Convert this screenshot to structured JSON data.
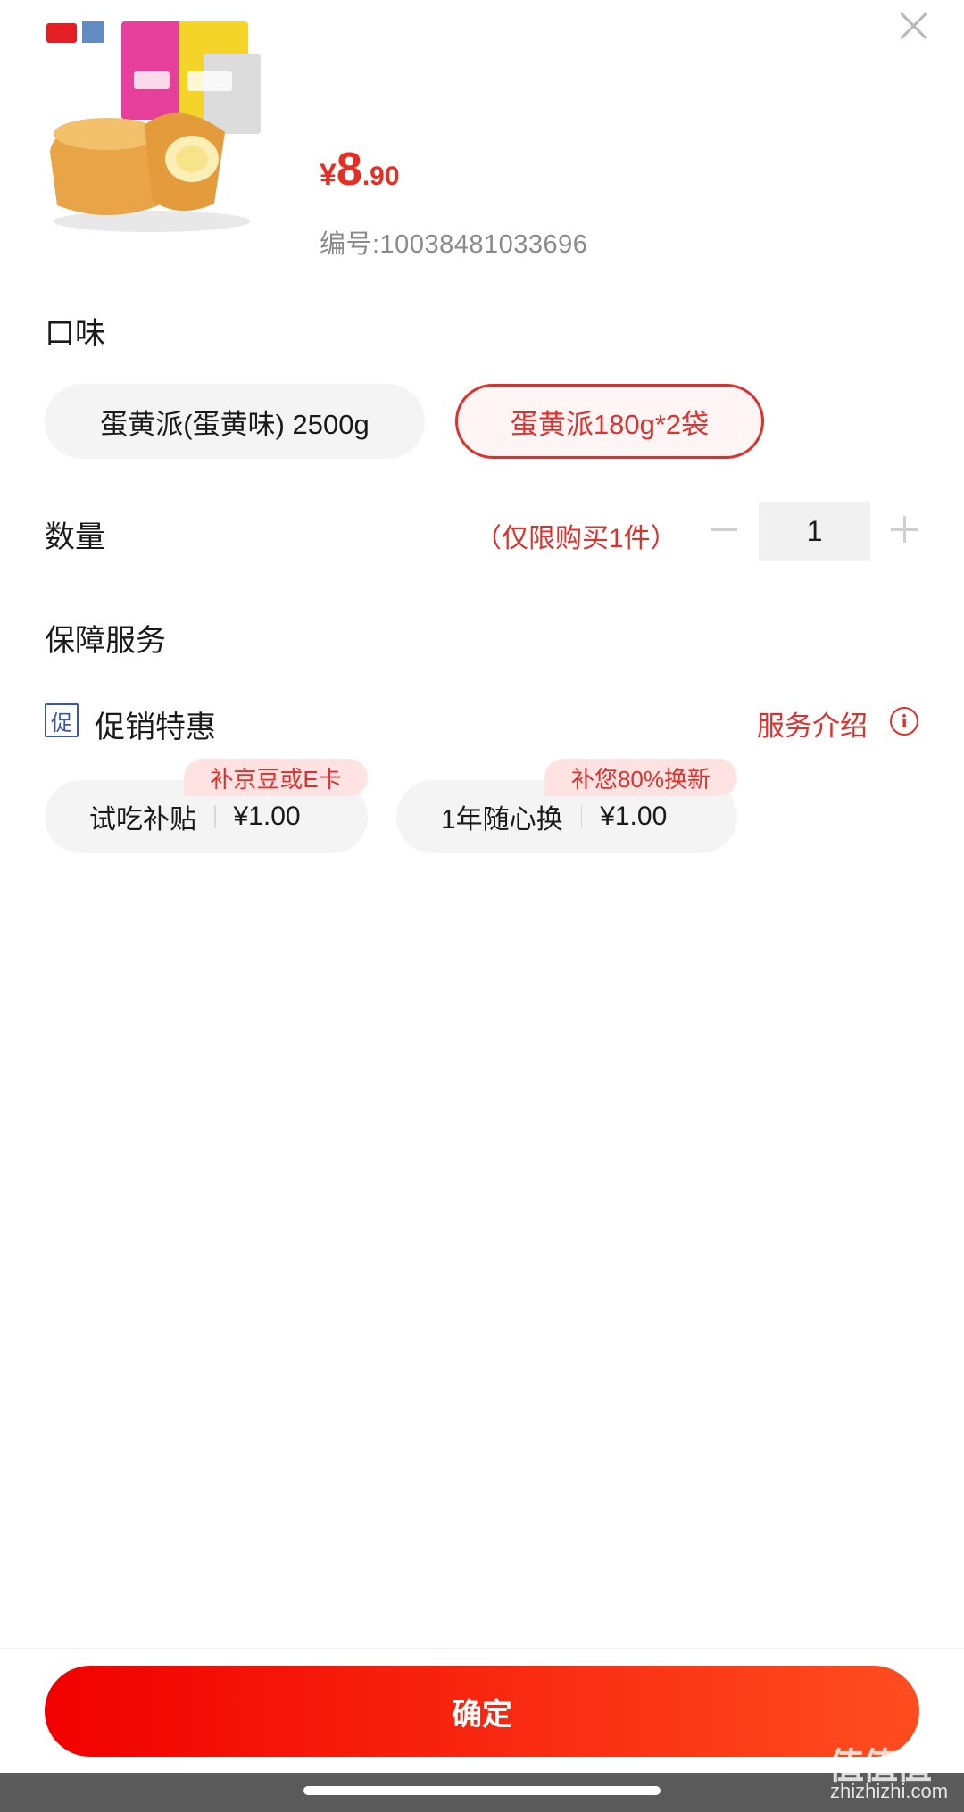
{
  "product": {
    "price_symbol": "¥",
    "price_integer": "8",
    "price_decimal": ".90",
    "sku": "编号:10038481033696"
  },
  "flavor": {
    "title": "口味",
    "options": [
      {
        "label": "蛋黄派(蛋黄味) 2500g",
        "selected": false
      },
      {
        "label": "蛋黄派180g*2袋",
        "selected": true
      }
    ]
  },
  "quantity": {
    "title": "数量",
    "limit_note": "（仅限购买1件）",
    "value": "1"
  },
  "guarantee": {
    "title": "保障服务"
  },
  "promotion": {
    "icon_char": "促",
    "title": "促销特惠",
    "service_link": "服务介绍",
    "info_icon_char": "i",
    "cards": [
      {
        "tag": "补京豆或E卡",
        "name": "试吃补贴",
        "price": "¥1.00"
      },
      {
        "tag": "补您80%换新",
        "name": "1年随心换",
        "price": "¥1.00"
      }
    ]
  },
  "confirm_label": "确定",
  "watermark": {
    "main": "值值值",
    "sub": "zhizhizhi.com"
  },
  "colors": {
    "accent": "#e0302c",
    "button_start": "#f10000",
    "button_end": "#ff4d1f",
    "promo_icon": "#3b58a8"
  },
  "icons": [
    "close-icon",
    "minus-icon",
    "plus-icon",
    "promo-icon",
    "info-icon"
  ]
}
